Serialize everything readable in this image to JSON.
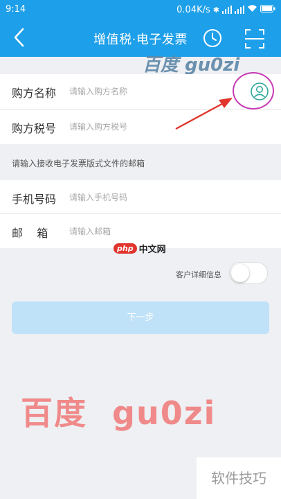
{
  "status_bar": {
    "time": "9:14",
    "net_speed": "0.04K/s",
    "battery": ""
  },
  "nav": {
    "title": "增值税·电子发票",
    "back_icon": "back-arrow-icon",
    "history_icon": "clock-icon",
    "scan_icon": "scan-icon"
  },
  "buyer": {
    "name_label": "购方名称",
    "name_placeholder": "请输入购方名称",
    "tax_label": "购方税号",
    "tax_placeholder": "请输入购方税号"
  },
  "email_hint": "请输入接收电子发票版式文件的邮箱",
  "contact": {
    "phone_label": "手机号码",
    "phone_placeholder": "请输入手机号码",
    "email_label": "邮    箱",
    "email_placeholder": "请输入邮箱"
  },
  "php_logo": {
    "badge": "php",
    "text": "中文网"
  },
  "details_toggle": {
    "label": "客户详细信息",
    "on": false
  },
  "next_button": "下一步",
  "watermarks": {
    "top": "百度 gu0zi",
    "big": "百度  gu0zi",
    "corner": "软件技巧"
  },
  "colors": {
    "primary": "#1e9fe9",
    "button_disabled": "#bfe2f8",
    "annotation": "#c93ab5",
    "arrow": "#e0342c"
  }
}
